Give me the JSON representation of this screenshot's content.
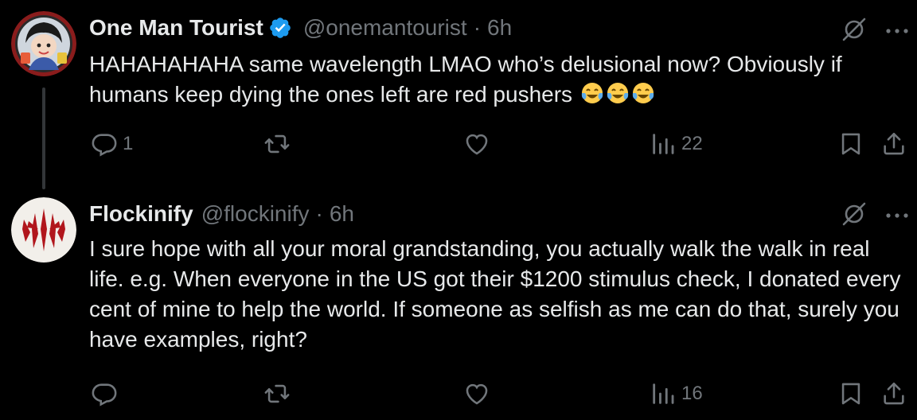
{
  "tweets": [
    {
      "author_name": "One Man Tourist",
      "handle": "@onemantourist",
      "separator": "·",
      "time": "6h",
      "verified": true,
      "text": "HAHAHAHAHA same wavelength LMAO who’s delusional now? Obviously if humans keep dying the ones left are red pushers",
      "emojis": [
        "face-with-tears-of-joy",
        "face-with-tears-of-joy",
        "face-with-tears-of-joy"
      ],
      "replies": "1",
      "reposts": "",
      "likes": "",
      "views": "22"
    },
    {
      "author_name": "Flockinify",
      "handle": "@flockinify",
      "separator": "·",
      "time": "6h",
      "verified": false,
      "text": "I sure hope with all your moral grandstanding, you actually walk the walk in real life. e.g. When everyone in the US got their $1200 stimulus check, I donated every cent of mine to help the world. If someone as selfish as me can do that, surely you have examples, right?",
      "replies": "",
      "reposts": "",
      "likes": "",
      "views": "16"
    }
  ],
  "colors": {
    "background": "#000000",
    "text": "#e7e9ea",
    "muted": "#71767b",
    "verified": "#1d9bf0",
    "thread_line": "#333639"
  },
  "icons": [
    "reply-icon",
    "repost-icon",
    "like-icon",
    "views-icon",
    "bookmark-icon",
    "share-icon",
    "grok-icon",
    "more-icon",
    "verified-badge-icon"
  ]
}
